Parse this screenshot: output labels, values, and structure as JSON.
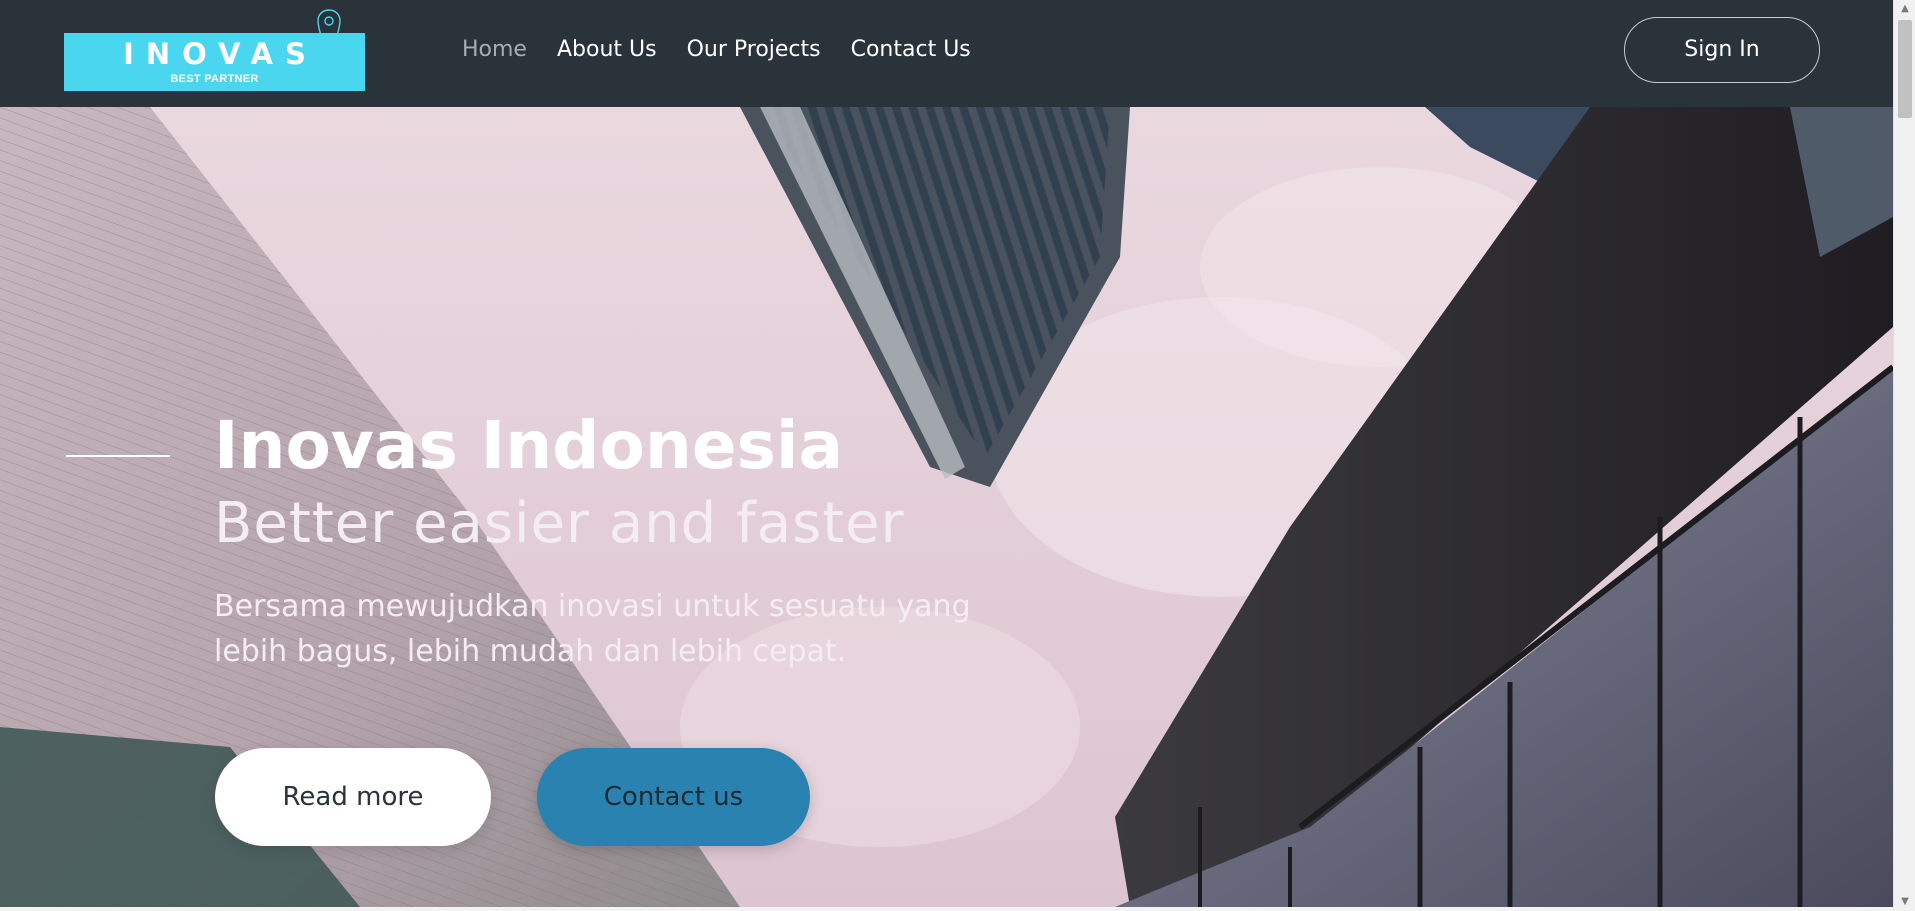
{
  "brand": {
    "name": "INOVAS",
    "tagline": "BEST PARTNER",
    "logo_bg": "#4ad6ee",
    "icon": "map-pin-icon"
  },
  "nav": {
    "items": [
      {
        "label": "Home",
        "active": true
      },
      {
        "label": "About Us",
        "active": false
      },
      {
        "label": "Our Projects",
        "active": false
      },
      {
        "label": "Contact Us",
        "active": false
      }
    ],
    "signin_label": "Sign In",
    "bg_color": "#2a323a"
  },
  "hero": {
    "title": "Inovas Indonesia",
    "subtitle": "Better easier and faster",
    "description": "Bersama mewujudkan inovasi untuk sesuatu yang lebih bagus, lebih mudah dan lebih cepat.",
    "buttons": {
      "read_more": "Read more",
      "contact": "Contact us"
    },
    "accent_color": "#2a82b0"
  },
  "scrollbar": {
    "up_icon": "triangle-up-icon",
    "down_icon": "triangle-down-icon"
  }
}
